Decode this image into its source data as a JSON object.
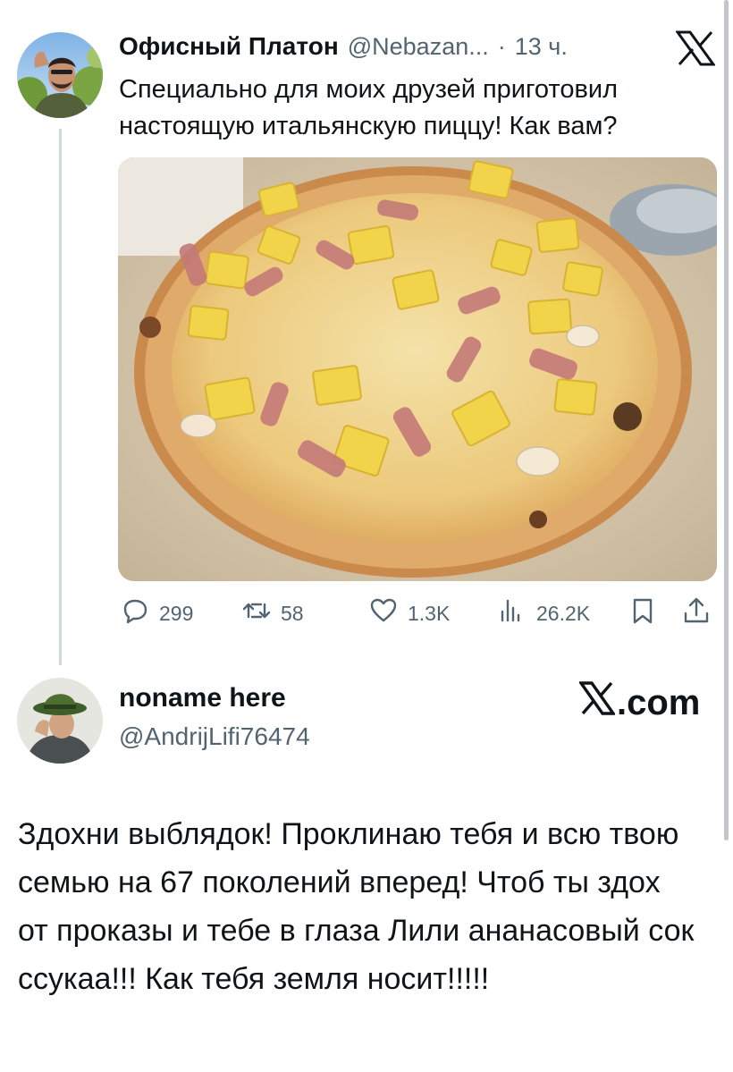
{
  "tweet": {
    "display_name": "Офисный Платон",
    "handle": "@Nebazan...",
    "separator": "·",
    "time": "13 ч.",
    "text": "Специально для моих друзей приготовил настоящую итальянскую пиццу! Как вам?",
    "metrics": {
      "replies": "299",
      "retweets": "58",
      "likes": "1.3K",
      "views": "26.2K"
    }
  },
  "reply": {
    "display_name": "noname here",
    "handle": "@AndrijLifi76474",
    "brand": ".com",
    "text": "Здохни выблядок! Проклинаю тебя и всю твою семью на 67 поколений вперед! Чтоб ты здох от проказы и тебе в глаза Лили ананасовый сок ссукаа!!! Как тебя земля носит!!!!!"
  },
  "icons": {
    "reply": "reply-icon",
    "retweet": "retweet-icon",
    "like": "heart-icon",
    "views": "views-icon",
    "bookmark": "bookmark-icon",
    "share": "share-icon",
    "brand": "x-logo-icon"
  },
  "colors": {
    "text": "#0f1419",
    "secondary": "#536471",
    "thread_line": "#cfd9de"
  }
}
